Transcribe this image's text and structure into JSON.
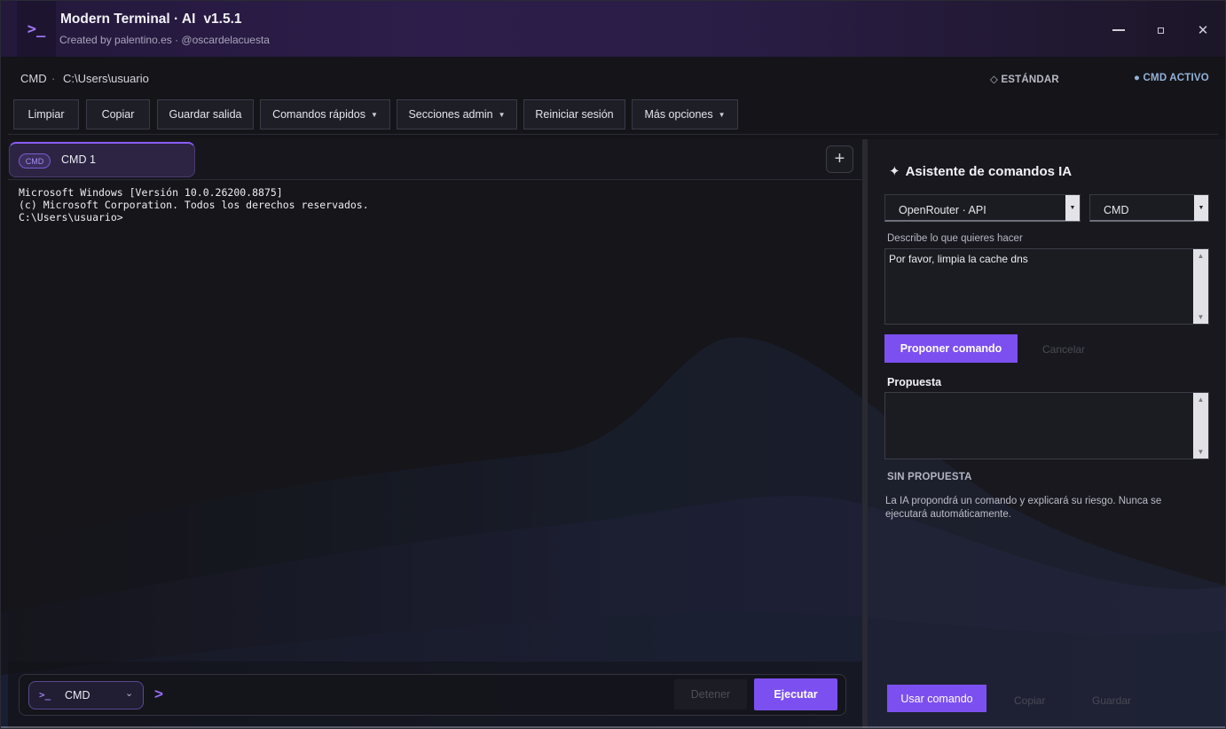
{
  "app": {
    "icon_glyph": ">_",
    "title": "Modern Terminal · AI",
    "version": "v1.5.1",
    "subtitle": "Created by palentino.es · @oscardelacuesta",
    "close_glyph": "✕"
  },
  "path_bar": {
    "shell": "CMD",
    "separator": "·",
    "directory": "C:\\Users\\usuario",
    "mode_standard": "◇ ESTÁNDAR",
    "mode_active": "● CMD ACTIVO"
  },
  "toolbar": {
    "clear": "Limpiar",
    "copy": "Copiar",
    "save_output": "Guardar salida",
    "quick_commands": "Comandos rápidos",
    "admin_sections": "Secciones admin",
    "restart_session": "Reiniciar sesión",
    "more_options": "Más opciones",
    "caret": "▼"
  },
  "tabs": [
    {
      "badge": "CMD",
      "label": "CMD 1",
      "active": true
    }
  ],
  "tab_add_glyph": "+",
  "terminal": {
    "lines": [
      "Microsoft Windows [Versión 10.0.26200.8875]",
      "(c) Microsoft Corporation. Todos los derechos reservados.",
      "C:\\Users\\usuario>"
    ]
  },
  "input_bar": {
    "shell_icon": ">_",
    "shell_label": "CMD",
    "chevron": "⌄",
    "prompt_glyph": ">",
    "stop_label": "Detener",
    "run_label": "Ejecutar"
  },
  "ai_panel": {
    "star": "✦",
    "title": "Asistente de comandos IA",
    "provider": "OpenRouter · API",
    "shell": "CMD",
    "combo_arrow": "▼",
    "describe_label": "Describe lo que quieres hacer",
    "request_text": "Por favor, limpia la cache dns",
    "propose_button": "Proponer comando",
    "cancel_button": "Cancelar",
    "proposal_label": "Propuesta",
    "proposal_text": "",
    "status": "SIN PROPUESTA",
    "info": "La IA propondrá un comando y explicará su riesgo. Nunca se ejecutará automáticamente.",
    "use_button": "Usar comando",
    "copy_button": "Copiar",
    "save_button": "Guardar",
    "scroll_up": "▲",
    "scroll_down": "▼"
  },
  "colors": {
    "accent": "#7c4ff0",
    "background": "#141419",
    "titlebar": "#2c1d4a",
    "mode_active": "#93b3d8"
  }
}
